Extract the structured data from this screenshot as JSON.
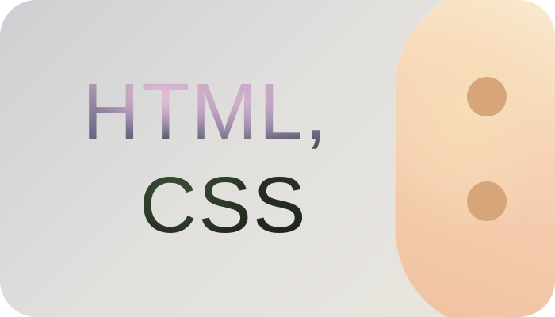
{
  "card": {
    "title_line_1": "HTML,",
    "title_line_2": "CSS"
  },
  "colors": {
    "background_start": "#cfcfd3",
    "background_end": "#ebe7df",
    "peach_shape_start": "#f9efd6",
    "peach_shape_end": "#efc0a0",
    "dot_color": "#d6a67a"
  }
}
